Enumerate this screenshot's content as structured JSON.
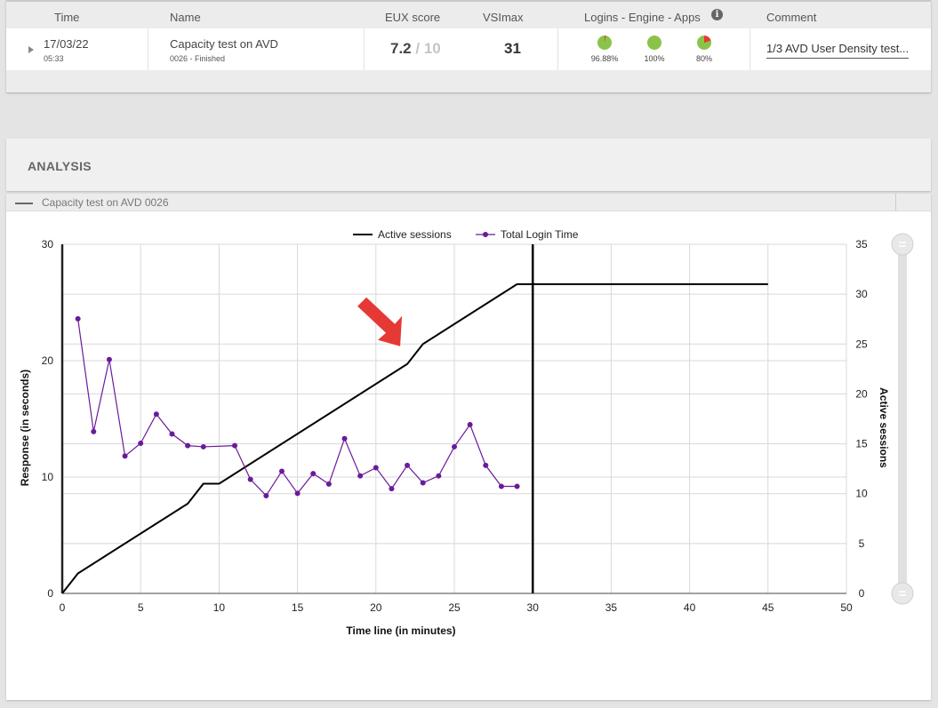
{
  "table": {
    "headers": {
      "time": "Time",
      "name": "Name",
      "eux": "EUX score",
      "vsimax": "VSImax",
      "logins": "Logins - Engine - Apps",
      "comment": "Comment"
    },
    "row": {
      "date": "17/03/22",
      "time": "05:33",
      "name": "Capacity test on AVD",
      "status": "0026 - Finished",
      "eux_score": "7.2",
      "eux_max": "/ 10",
      "vsimax": "31",
      "logins_pct": "96.88%",
      "engine_pct": "100%",
      "apps_pct": "80%",
      "comment": "1/3 AVD User Density test..."
    },
    "pie_colors": {
      "ok": "#8bc34a",
      "fail": "#e53935"
    },
    "pie_values": {
      "logins": 0.9688,
      "engine": 1.0,
      "apps": 0.8
    }
  },
  "analysis": {
    "title": "ANALYSIS",
    "series_tab_label": "Capacity test on AVD 0026"
  },
  "chart_data": {
    "type": "line",
    "legend": [
      "Active sessions",
      "Total Login Time"
    ],
    "legend_placement": "top-center",
    "xlabel": "Time line (in minutes)",
    "ylabel_left": "Response (in seconds)",
    "ylabel_right": "Active sessions",
    "xlim": [
      0,
      50
    ],
    "xticks": [
      0,
      5,
      10,
      15,
      20,
      25,
      30,
      35,
      40,
      45,
      50
    ],
    "ylim_left": [
      0,
      30
    ],
    "yticks_left": [
      0,
      10,
      20,
      30
    ],
    "ylim_right": [
      0,
      35
    ],
    "yticks_right": [
      0,
      5,
      10,
      15,
      20,
      25,
      30,
      35
    ],
    "grid": true,
    "vertical_marker_x": 30,
    "series": [
      {
        "name": "Active sessions",
        "axis": "right",
        "color": "#000000",
        "x": [
          0,
          1,
          8,
          9,
          10,
          22,
          23,
          29,
          45
        ],
        "y": [
          0,
          2,
          9,
          11,
          11,
          23,
          25,
          31,
          31
        ]
      },
      {
        "name": "Total Login Time",
        "axis": "left",
        "color": "#6a1b9a",
        "x": [
          1,
          2,
          3,
          4,
          5,
          6,
          7,
          8,
          9,
          11,
          12,
          13,
          14,
          15,
          16,
          17,
          18,
          19,
          20,
          21,
          22,
          23,
          24,
          25,
          26,
          27,
          28,
          29
        ],
        "y": [
          23.6,
          13.9,
          20.1,
          11.8,
          12.9,
          15.4,
          13.7,
          12.7,
          12.6,
          12.7,
          9.8,
          8.4,
          10.5,
          8.6,
          10.3,
          9.4,
          13.3,
          10.1,
          10.8,
          9.0,
          11.0,
          9.5,
          10.1,
          12.6,
          14.5,
          11.0,
          9.2,
          9.2
        ]
      }
    ],
    "annotation": {
      "type": "arrow",
      "color": "#e53935",
      "points_to_x": 22
    }
  }
}
